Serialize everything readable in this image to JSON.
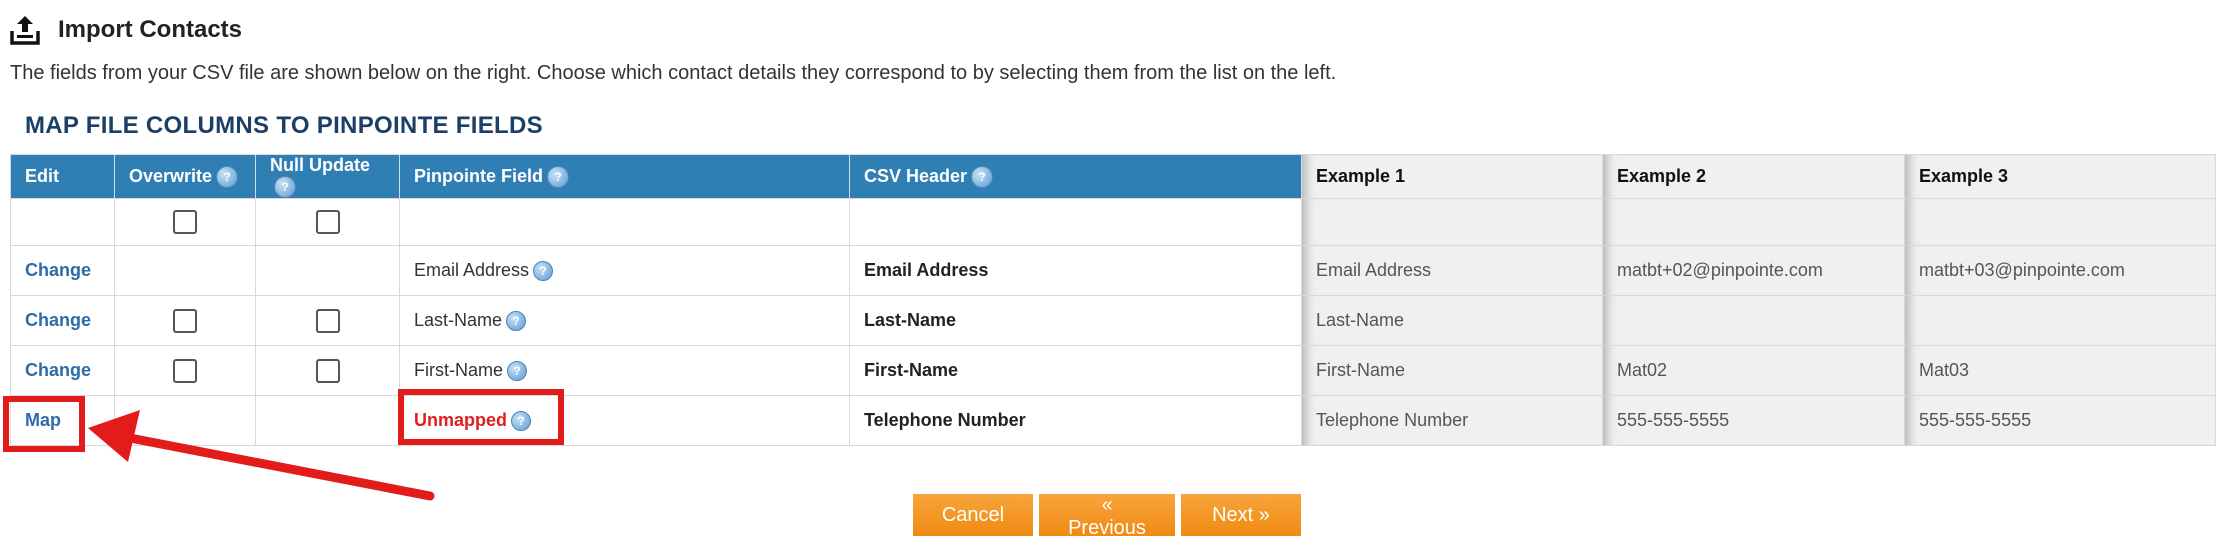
{
  "page": {
    "title": "Import Contacts",
    "description": "The fields from your CSV file are shown below on the right. Choose which contact details they correspond to by selecting them from the list on the left.",
    "section_title": "MAP FILE COLUMNS TO PINPOINTE FIELDS"
  },
  "table": {
    "headers": {
      "edit": "Edit",
      "overwrite": "Overwrite",
      "null_update": "Null Update",
      "pinpointe_field": "Pinpointe Field",
      "csv_header": "CSV Header",
      "example1": "Example 1",
      "example2": "Example 2",
      "example3": "Example 3"
    },
    "help_glyph": "?",
    "rows": [
      {
        "edit": "Change",
        "field": "Email Address",
        "csv": "Email Address",
        "ex1": "Email Address",
        "ex2": "matbt+02@pinpointe.com",
        "ex3": "matbt+03@pinpointe.com"
      },
      {
        "edit": "Change",
        "field": "Last-Name",
        "csv": "Last-Name",
        "ex1": "Last-Name",
        "ex2": "",
        "ex3": ""
      },
      {
        "edit": "Change",
        "field": "First-Name",
        "csv": "First-Name",
        "ex1": "First-Name",
        "ex2": "Mat02",
        "ex3": "Mat03"
      },
      {
        "edit": "Map",
        "field": "Unmapped",
        "csv": "Telephone Number",
        "ex1": "Telephone Number",
        "ex2": "555-555-5555",
        "ex3": "555-555-5555"
      }
    ]
  },
  "buttons": {
    "cancel": "Cancel",
    "previous": "« Previous",
    "next": "Next »"
  },
  "colors": {
    "header_blue": "#2f7fb5",
    "link_blue": "#2d6ca8",
    "annotation_red": "#e21b1b",
    "button_orange": "#f08a12"
  }
}
